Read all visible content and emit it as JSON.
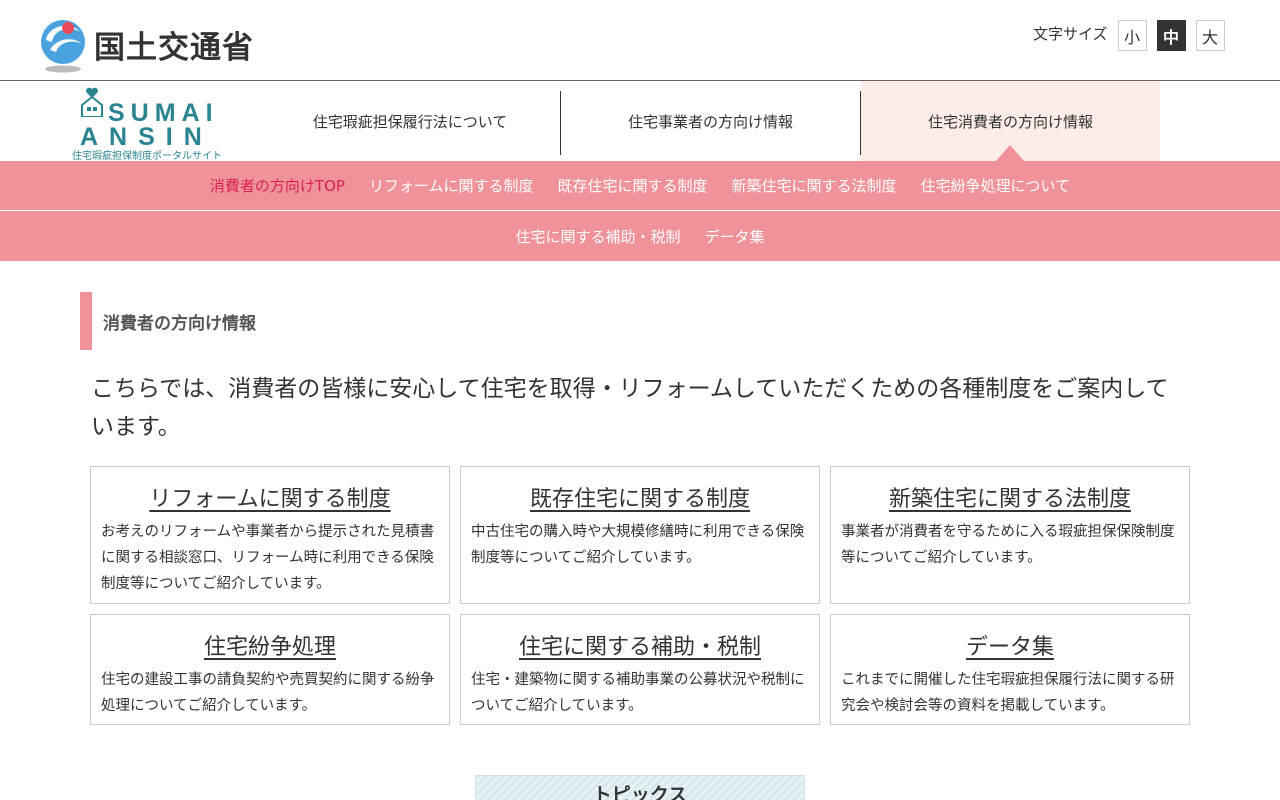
{
  "header": {
    "ministry_name": "国土交通省",
    "font_size_label": "文字サイズ",
    "font_size_options": [
      "小",
      "中",
      "大"
    ],
    "font_size_selected": "中"
  },
  "portal": {
    "logo_line1": "SUMAI",
    "logo_line2": "ANSIN",
    "logo_caption": "住宅瑕疵担保制度ポータルサイト",
    "tabs": [
      {
        "label": "住宅瑕疵担保履行法について"
      },
      {
        "label": "住宅事業者の方向け情報"
      },
      {
        "label": "住宅消費者の方向け情報"
      }
    ],
    "active_tab": "住宅消費者の方向け情報"
  },
  "subnav": {
    "row1": [
      {
        "label": "消費者の方向けTOP"
      },
      {
        "label": "リフォームに関する制度"
      },
      {
        "label": "既存住宅に関する制度"
      },
      {
        "label": "新築住宅に関する法制度"
      },
      {
        "label": "住宅紛争処理について"
      }
    ],
    "row2": [
      {
        "label": "住宅に関する補助・税制"
      },
      {
        "label": "データ集"
      }
    ]
  },
  "main": {
    "section_title": "消費者の方向け情報",
    "lead": "こちらでは、消費者の皆様に安心して住宅を取得・リフォームしていただくための各種制度をご案内しています。",
    "cards": [
      {
        "title": "リフォームに関する制度",
        "description": "お考えのリフォームや事業者から提示された見積書に関する相談窓口、リフォーム時に利用できる保険制度等についてご紹介しています。"
      },
      {
        "title": "既存住宅に関する制度",
        "description": "中古住宅の購入時や大規模修繕時に利用できる保険制度等についてご紹介しています。"
      },
      {
        "title": "新築住宅に関する法制度",
        "description": "事業者が消費者を守るために入る瑕疵担保保険制度等についてご紹介しています。"
      },
      {
        "title": "住宅紛争処理",
        "description": "住宅の建設工事の請負契約や売買契約に関する紛争処理についてご紹介しています。"
      },
      {
        "title": "住宅に関する補助・税制",
        "description": "住宅・建築物に関する補助事業の公募状況や税制についてご紹介しています。"
      },
      {
        "title": "データ集",
        "description": "これまでに開催した住宅瑕疵担保履行法に関する研究会や検討会等の資料を掲載しています。"
      }
    ],
    "topics_title": "トピックス"
  },
  "colors": {
    "accent_pink": "#f0929a",
    "active_tab_bg": "#fdece8",
    "current_subnav_text": "#d6234a",
    "sumai_teal": "#2b8590",
    "mlit_blue": "#4aa3df"
  }
}
